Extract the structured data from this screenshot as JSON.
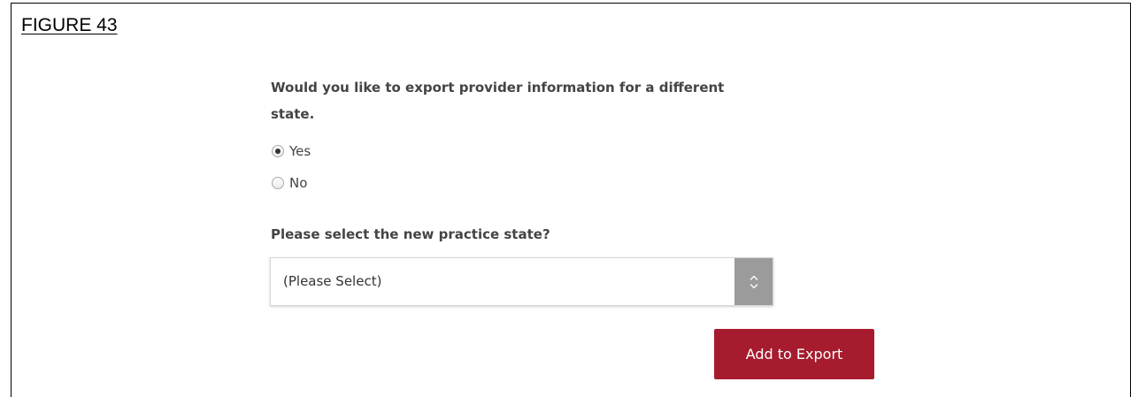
{
  "figure_label": "FIGURE 43",
  "form": {
    "question": "Would you like to export provider information for a different state.",
    "options": [
      {
        "label": "Yes",
        "selected": true
      },
      {
        "label": "No",
        "selected": false
      }
    ],
    "state_prompt": "Please select the new practice state?",
    "state_select_value": "(Please Select)",
    "submit_label": "Add to Export"
  },
  "colors": {
    "button_bg": "#a61c2e",
    "select_arrow_bg": "#9b9b9b"
  },
  "icons": {
    "select_arrow": "chevron-up-down-icon"
  }
}
